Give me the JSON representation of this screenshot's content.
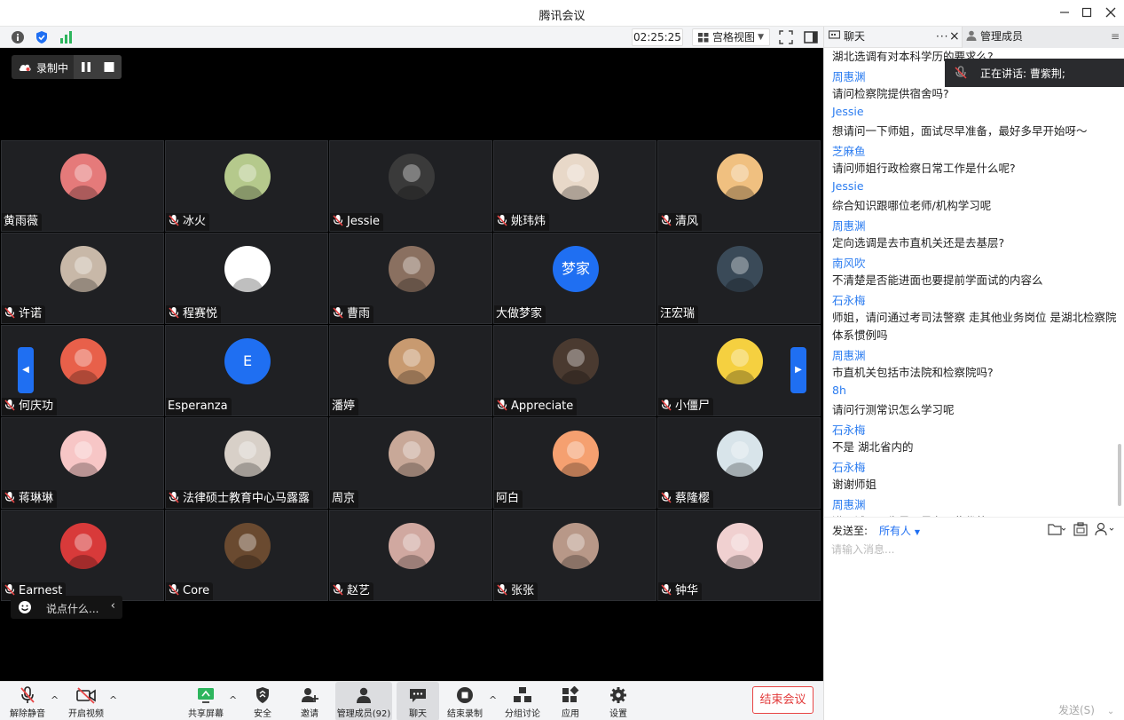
{
  "window": {
    "title": "腾讯会议"
  },
  "toolbar": {
    "timer": "02:25:25",
    "view_mode": "宫格视图"
  },
  "recording": {
    "label": "录制中"
  },
  "participants": [
    {
      "name": "黄雨薇",
      "muted": false,
      "avatar_color": "#e57a7a"
    },
    {
      "name": "冰火",
      "muted": true,
      "avatar_color": "#b5c98c"
    },
    {
      "name": "Jessie",
      "muted": true,
      "avatar_color": "#3a3a3a"
    },
    {
      "name": "姚玮炜",
      "muted": true,
      "avatar_color": "#e8d8c8"
    },
    {
      "name": "清风",
      "muted": true,
      "avatar_color": "#f0c080"
    },
    {
      "name": "许诺",
      "muted": true,
      "avatar_color": "#c8b8a8"
    },
    {
      "name": "程赛悦",
      "muted": true,
      "avatar_color": "#ffffff"
    },
    {
      "name": "曹雨",
      "muted": true,
      "avatar_color": "#8a7060"
    },
    {
      "name": "大做梦家",
      "muted": false,
      "avatar_text": "梦家",
      "avatar_color": "#1f6ff2"
    },
    {
      "name": "汪宏瑞",
      "muted": false,
      "avatar_color": "#3a4a58"
    },
    {
      "name": "何庆功",
      "muted": true,
      "avatar_color": "#e8604a"
    },
    {
      "name": "Esperanza",
      "muted": false,
      "avatar_text": "E",
      "avatar_color": "#1f6ff2"
    },
    {
      "name": "潘婷",
      "muted": false,
      "avatar_color": "#c89a70"
    },
    {
      "name": "Appreciate",
      "muted": true,
      "avatar_color": "#4a3a30"
    },
    {
      "name": "小僵尸",
      "muted": true,
      "avatar_color": "#f5d040"
    },
    {
      "name": "蒋琳琳",
      "muted": true,
      "avatar_color": "#f7c6c6"
    },
    {
      "name": "法律硕士教育中心马露露",
      "muted": true,
      "avatar_color": "#d8d0c8"
    },
    {
      "name": "周京",
      "muted": false,
      "avatar_color": "#c8a898"
    },
    {
      "name": "阿白",
      "muted": false,
      "avatar_color": "#f5a070"
    },
    {
      "name": "蔡隆樱",
      "muted": true,
      "avatar_color": "#d8e4ea"
    },
    {
      "name": "Earnest",
      "muted": true,
      "avatar_color": "#d83a3a"
    },
    {
      "name": "Core",
      "muted": true,
      "avatar_color": "#6a4a30"
    },
    {
      "name": "赵艺",
      "muted": true,
      "avatar_color": "#d0a8a0"
    },
    {
      "name": "张张",
      "muted": true,
      "avatar_color": "#b89888"
    },
    {
      "name": "钟华",
      "muted": true,
      "avatar_color": "#f0d0d0"
    }
  ],
  "reaction_box": {
    "placeholder": "说点什么..."
  },
  "bottom_bar": {
    "unmute": "解除静音",
    "start_video": "开启视频",
    "share_screen": "共享屏幕",
    "security": "安全",
    "invite": "邀请",
    "manage_members": "管理成员(92)",
    "chat": "聊天",
    "end_recording": "结束录制",
    "breakout": "分组讨论",
    "apps": "应用",
    "settings": "设置",
    "end_meeting": "结束会议"
  },
  "chat_panel": {
    "tab_chat": "聊天",
    "tab_members": "管理成员",
    "speaking": "正在讲话: 曹紫荆;",
    "messages": [
      {
        "sender": "",
        "text": "湖北选调有对本科学历的要求么?"
      },
      {
        "sender": "周惠渊",
        "text": "请问检察院提供宿舍吗?"
      },
      {
        "sender": "Jessie",
        "text": "想请问一下师姐，面试尽早准备，最好多早开始呀～"
      },
      {
        "sender": "芝麻鱼",
        "text": "请问师姐行政检察日常工作是什么呢?"
      },
      {
        "sender": "Jessie",
        "text": "综合知识跟哪位老师/机构学习呢"
      },
      {
        "sender": "周惠渊",
        "text": "定向选调是去市直机关还是去基层?"
      },
      {
        "sender": "南风吹",
        "text": "不清楚是否能进面也要提前学面试的内容么"
      },
      {
        "sender": "石永梅",
        "text": "师姐，请问通过考司法警察 走其他业务岗位 是湖北检察院体系惯例吗"
      },
      {
        "sender": "周惠渊",
        "text": "市直机关包括市法院和检察院吗?"
      },
      {
        "sender": "8h",
        "text": "请问行测常识怎么学习呢"
      },
      {
        "sender": "石永梅",
        "text": "不是 湖北省内的"
      },
      {
        "sender": "石永梅",
        "text": "谢谢师姐"
      },
      {
        "sender": "周惠渊",
        "text": "进面试了男生是不是有一些优势"
      }
    ],
    "send_to_label": "发送至:",
    "recipient": "所有人",
    "input_placeholder": "请输入消息...",
    "send_button": "发送(S)"
  }
}
